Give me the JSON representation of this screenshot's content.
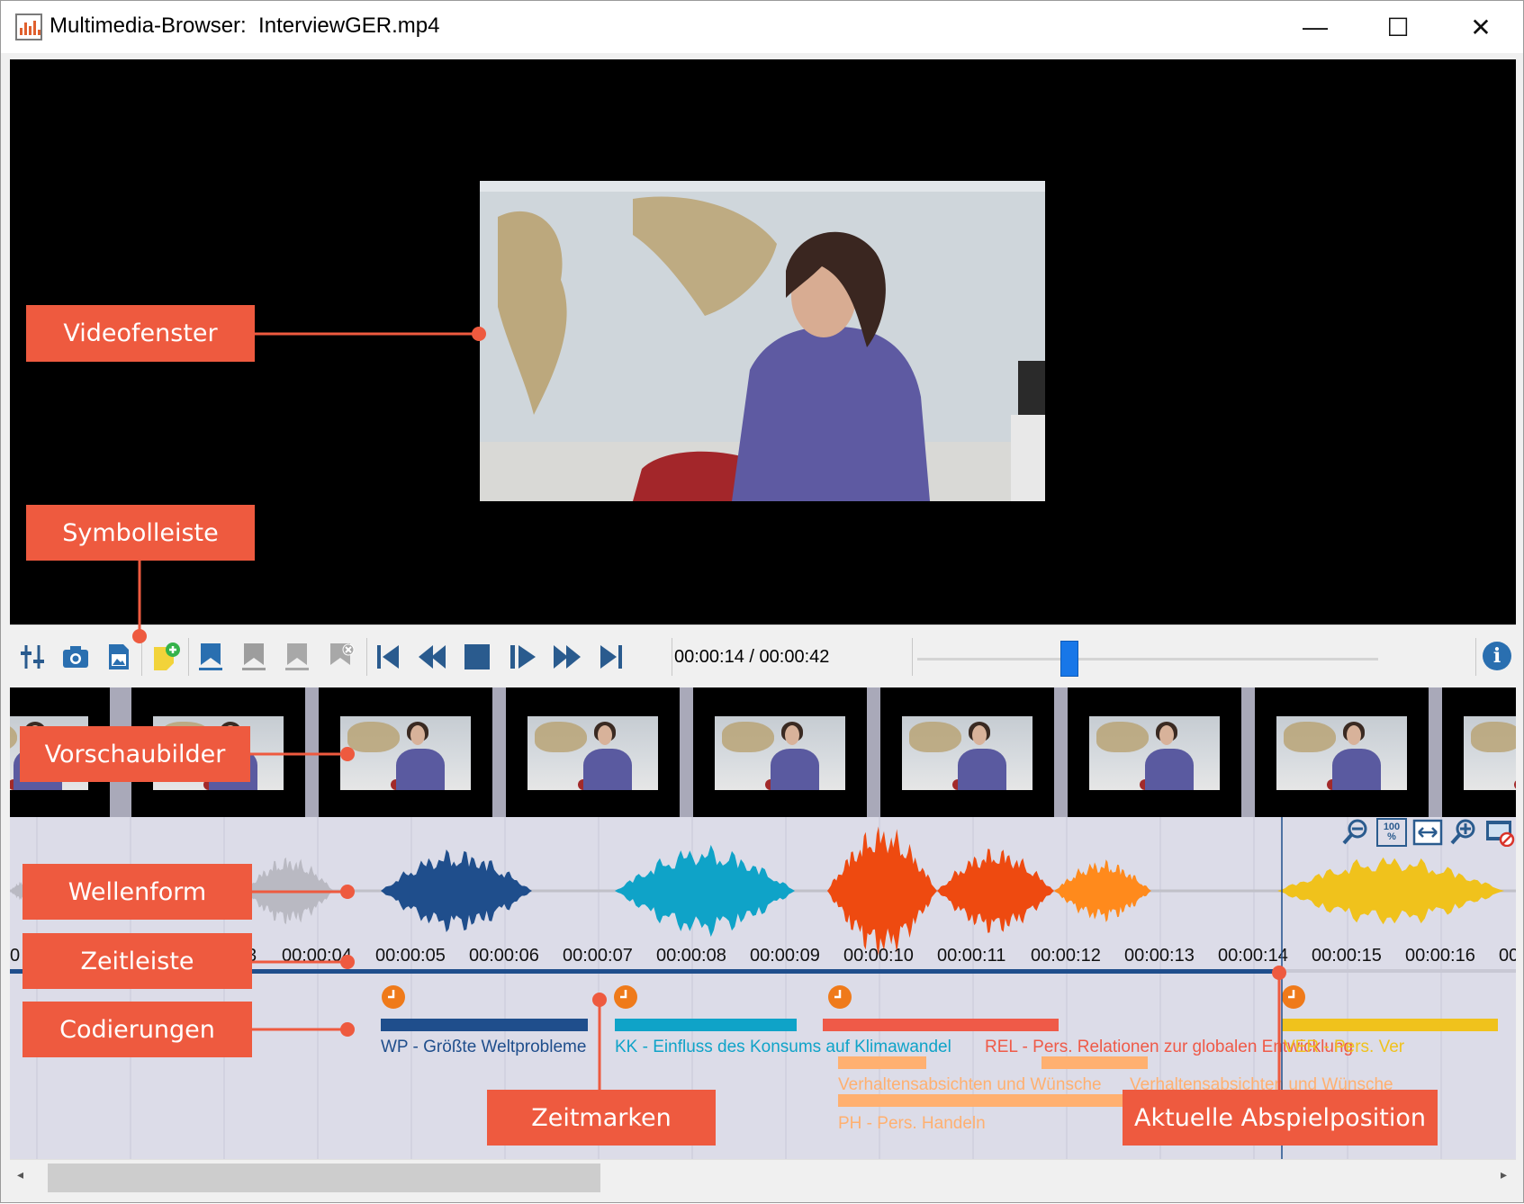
{
  "window": {
    "title": "Multimedia-Browser:  InterviewGER.mp4",
    "minimize_glyph": "—",
    "maximize_glyph": "☐",
    "close_glyph": "✕"
  },
  "toolbar": {
    "timecode": "00:00:14 / 00:00:42",
    "playback_position_fraction": 0.33,
    "icons": [
      "settings-sliders-icon",
      "camera-icon",
      "image-icon",
      "add-memo-icon",
      "bookmark-blue-icon",
      "bookmark-gray-icon",
      "bookmark-gray-2-icon",
      "bookmark-delete-icon",
      "skip-start-icon",
      "rewind-icon",
      "stop-icon",
      "play-icon",
      "fast-forward-icon",
      "skip-end-icon",
      "info-icon"
    ],
    "info_glyph": "i"
  },
  "zoom_tools": [
    "zoom-out-icon",
    "zoom-100-icon",
    "fit-width-icon",
    "zoom-in-icon",
    "video-options-icon"
  ],
  "zoom_100_label": "100\n%",
  "timeline": {
    "ticks": [
      "0",
      "3",
      "00:00:04",
      "00:00:05",
      "00:00:06",
      "00:00:07",
      "00:00:08",
      "00:00:09",
      "00:00:10",
      "00:00:11",
      "00:00:12",
      "00:00:13",
      "00:00:14",
      "00:00:15",
      "00:00:16",
      "00"
    ]
  },
  "codings": [
    {
      "label": "WP - Größte Weltprobleme",
      "color": "#1f4e8c"
    },
    {
      "label": "KK - Einfluss des Konsums auf Klimawandel",
      "color": "#0fa3c8"
    },
    {
      "label": "REL - Pers. Relationen zur globalen Entwicklung",
      "color": "#ef5a48"
    },
    {
      "label": "VER - Pers. Ver",
      "color": "#f0c21c"
    },
    {
      "label": "Verhaltensabsichten und Wünsche",
      "color": "#ffb070"
    },
    {
      "label": "Verhaltensabsichten und Wünsche",
      "color": "#ffb070"
    },
    {
      "label": "PH - Pers. Handeln",
      "color": "#ffb070"
    }
  ],
  "callouts": {
    "videofenster": "Videofenster",
    "symbolleiste": "Symbolleiste",
    "vorschaubilder": "Vorschaubilder",
    "wellenform": "Wellenform",
    "zeitleiste": "Zeitleiste",
    "codierungen": "Codierungen",
    "zeitmarken": "Zeitmarken",
    "abspielposition": "Aktuelle Abspielposition"
  },
  "colors": {
    "callout": "#ee5a3f",
    "playhead": "#1f4e8c",
    "wave_gray": "#b9b9c2",
    "wave_navy": "#1f4e8c",
    "wave_cyan": "#0fa3c8",
    "wave_orange_red": "#ee4a10",
    "wave_orange": "#ff8a1c",
    "wave_yellow": "#f0c21c",
    "time_marker": "#ef7a1a"
  }
}
